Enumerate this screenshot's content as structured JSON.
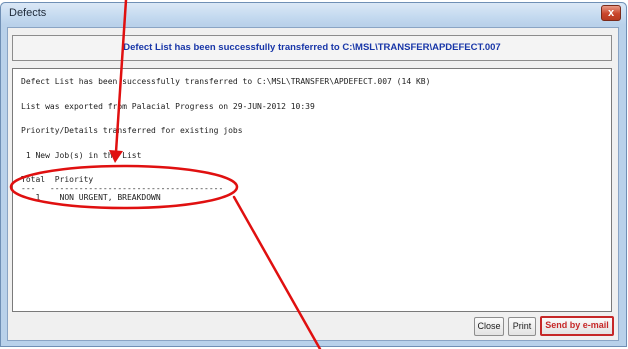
{
  "window": {
    "title": "Defects",
    "close_glyph": "x"
  },
  "header": {
    "message": "Defect List has been successfully transferred to C:\\MSL\\TRANSFER\\APDEFECT.007"
  },
  "memo": {
    "lines": [
      "Defect List has been successfully transferred to C:\\MSL\\TRANSFER\\APDEFECT.007 (14 KB)",
      "List was exported from Palacial Progress on 29-JUN-2012 10:39",
      "Priority/Details transferred for existing jobs",
      " 1 New Job(s) in the List",
      "Total  Priority",
      "---   ------------------------------------",
      "   1    NON URGENT, BREAKDOWN"
    ]
  },
  "buttons": {
    "close": "Close",
    "print": "Print",
    "email": "Send by e-mail"
  },
  "colors": {
    "annotation": "#e01010",
    "email_button": "#c62828",
    "header_text": "#1836a8"
  }
}
